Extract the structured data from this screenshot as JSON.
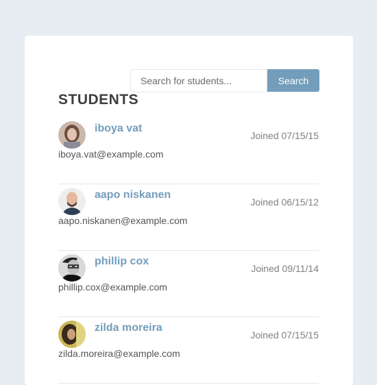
{
  "search": {
    "placeholder": "Search for students...",
    "button_label": "Search"
  },
  "title": "STUDENTS",
  "students": [
    {
      "name": "iboya vat",
      "email": "iboya.vat@example.com",
      "joined": "Joined 07/15/15",
      "avatar": "woman-avatar-icon"
    },
    {
      "name": "aapo niskanen",
      "email": "aapo.niskanen@example.com",
      "joined": "Joined 06/15/12",
      "avatar": "bald-man-avatar-icon"
    },
    {
      "name": "phillip cox",
      "email": "phillip.cox@example.com",
      "joined": "Joined 09/11/14",
      "avatar": "man-glasses-avatar-icon"
    },
    {
      "name": "zilda moreira",
      "email": "zilda.moreira@example.com",
      "joined": "Joined 07/15/15",
      "avatar": "woman-avatar-icon"
    }
  ],
  "colors": {
    "background": "#e6eef4",
    "accent": "#739dbb",
    "title": "#3e3e3e"
  }
}
